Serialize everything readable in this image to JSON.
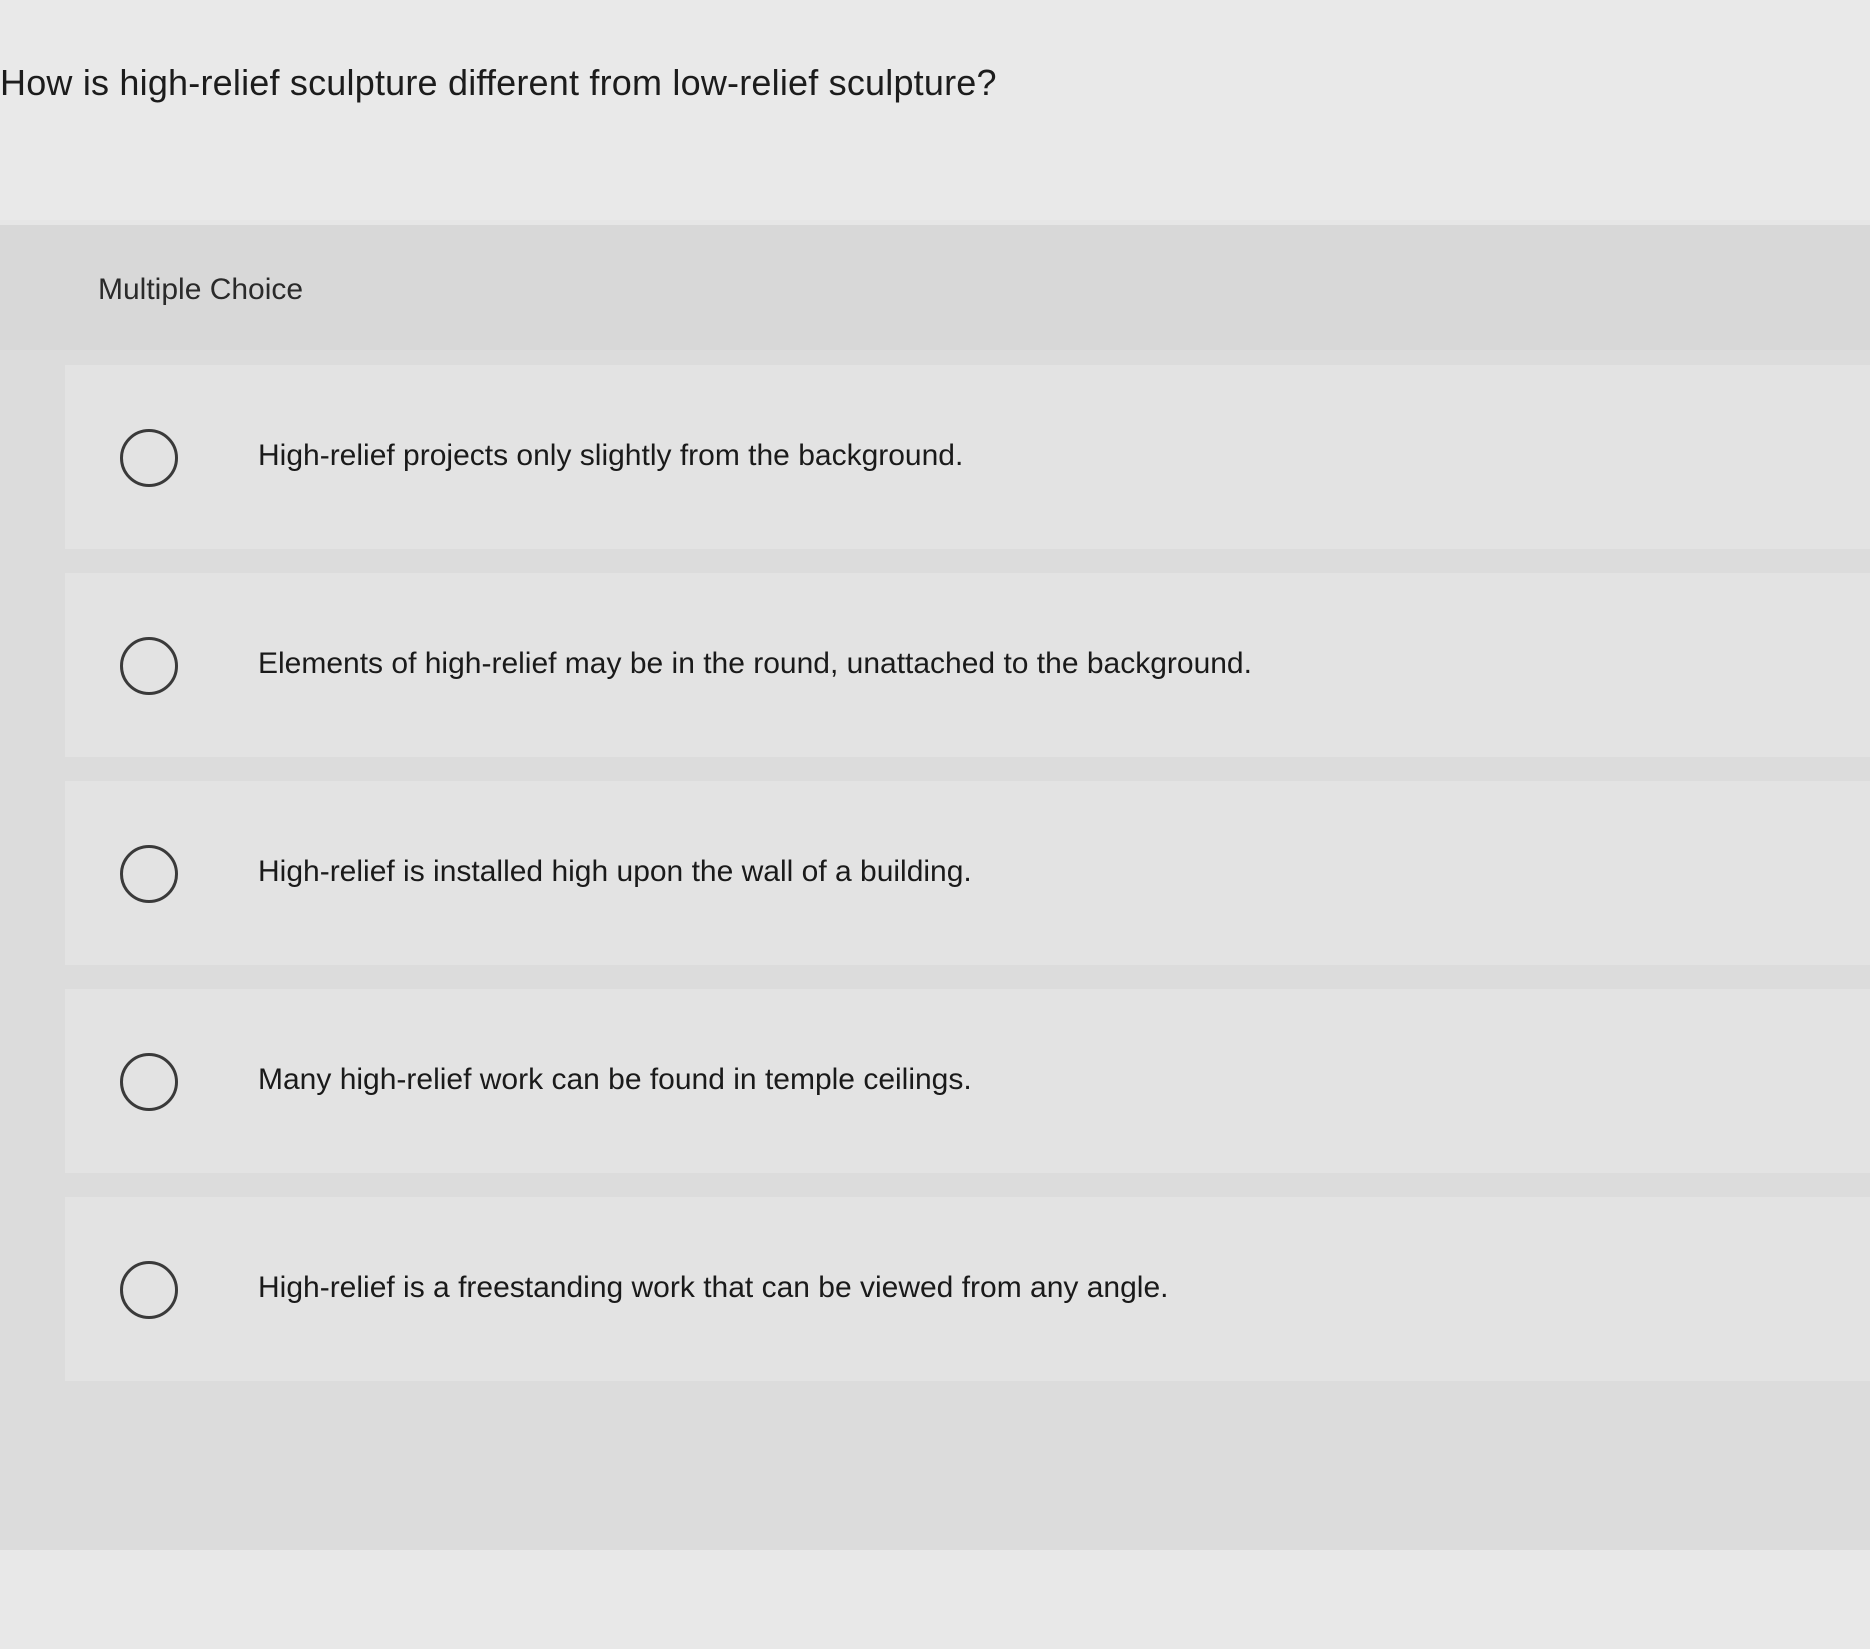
{
  "question": {
    "text": "How is high-relief sculpture different from low-relief sculpture?"
  },
  "multiple_choice": {
    "label": "Multiple Choice",
    "options": [
      {
        "text": "High-relief projects only slightly from the background.",
        "selected": false
      },
      {
        "text": "Elements of high-relief may be in the round, unattached to the background.",
        "selected": false
      },
      {
        "text": "High-relief is installed high upon the wall of a building.",
        "selected": false
      },
      {
        "text": "Many high-relief work can be found in temple ceilings.",
        "selected": false
      },
      {
        "text": "High-relief is a freestanding work that can be viewed from any angle.",
        "selected": false
      }
    ]
  }
}
